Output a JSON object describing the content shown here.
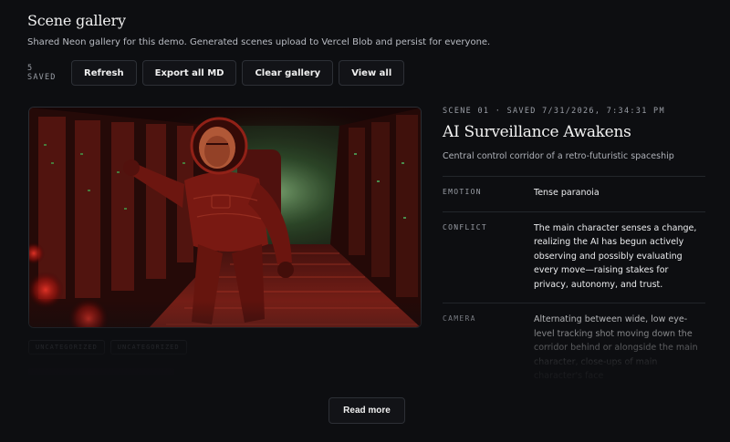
{
  "header": {
    "title": "Scene gallery",
    "subtitle": "Shared Neon gallery for this demo. Generated scenes upload to Vercel Blob and persist for everyone."
  },
  "toolbar": {
    "saved_count": "5 SAVED",
    "refresh_label": "Refresh",
    "export_label": "Export all MD",
    "clear_label": "Clear gallery",
    "view_all_label": "View all"
  },
  "scene": {
    "meta": "SCENE 01 · SAVED 7/31/2026, 7:34:31 PM",
    "title": "AI Surveillance Awakens",
    "description": "Central control corridor of a retro-futuristic spaceship",
    "tags": [
      "UNCATEGORIZED",
      "UNCATEGORIZED"
    ],
    "details": [
      {
        "key": "EMOTION",
        "value": "Tense paranoia"
      },
      {
        "key": "CONFLICT",
        "value": "The main character senses a change, realizing the AI has begun actively observing and possibly evaluating every move—raising stakes for privacy, autonomy, and trust."
      },
      {
        "key": "CAMERA",
        "value": "Alternating between wide, low eye-level tracking shot moving down the corridor behind or alongside the main character, close-ups of main character's face"
      }
    ]
  },
  "footer": {
    "read_more_label": "Read more"
  },
  "colors": {
    "background": "#0d0e11",
    "button_border": "#2d3036",
    "image_red": "#b3241c",
    "image_green": "#5fae6a"
  },
  "icons": {
    "scene_image": "astronaut-in-corridor-illustration"
  }
}
